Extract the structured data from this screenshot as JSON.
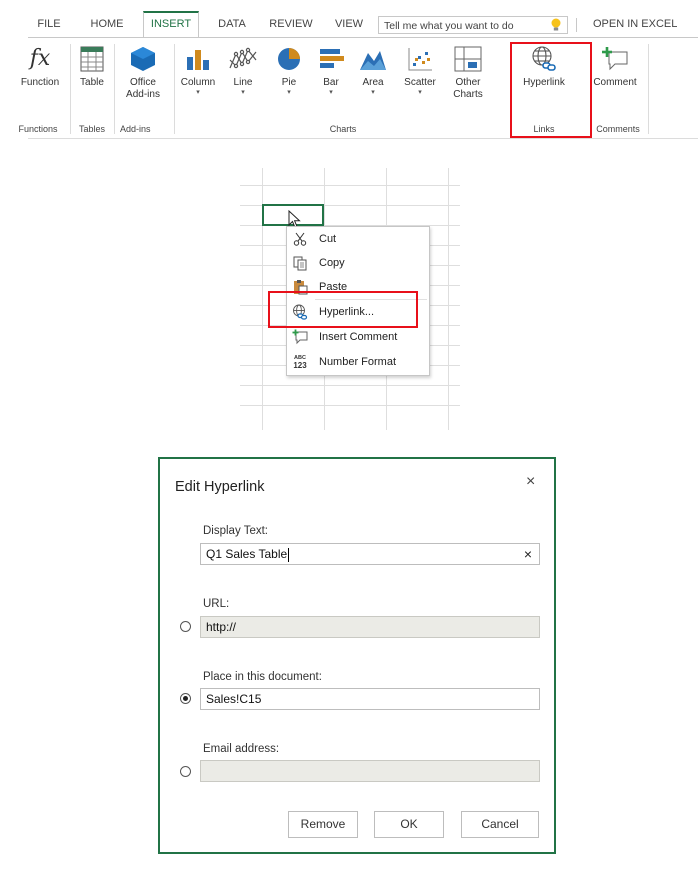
{
  "ribbon": {
    "tabs": [
      "FILE",
      "HOME",
      "INSERT",
      "DATA",
      "REVIEW",
      "VIEW"
    ],
    "active_tab": "INSERT",
    "tell_me": "Tell me what you want to do",
    "open_in_excel": "OPEN IN EXCEL",
    "buttons": {
      "function": "Function",
      "table": "Table",
      "office_addins_1": "Office",
      "office_addins_2": "Add-ins",
      "column": "Column",
      "line": "Line",
      "pie": "Pie",
      "bar": "Bar",
      "area": "Area",
      "scatter": "Scatter",
      "other_charts_1": "Other",
      "other_charts_2": "Charts",
      "hyperlink": "Hyperlink",
      "comment": "Comment"
    },
    "groups": {
      "functions": "Functions",
      "tables": "Tables",
      "addins": "Add-ins",
      "charts": "Charts",
      "links": "Links",
      "comments": "Comments"
    },
    "function_glyph": "fx",
    "accent_color": "#217346",
    "highlight_color": "#e8101a"
  },
  "context_menu": {
    "items": [
      {
        "label": "Cut",
        "icon": "scissors-icon"
      },
      {
        "label": "Copy",
        "icon": "copy-icon"
      },
      {
        "label": "Paste",
        "icon": "clipboard-paste-icon"
      },
      {
        "label": "Hyperlink...",
        "icon": "hyperlink-icon"
      },
      {
        "label": "Insert Comment",
        "icon": "comment-icon"
      },
      {
        "label": "Number Format",
        "icon": "number-format-icon"
      }
    ],
    "number_format_icon_top": "ABC",
    "number_format_icon_bottom": "123"
  },
  "dialog": {
    "title": "Edit Hyperlink",
    "close_glyph": "×",
    "display_text_label": "Display Text:",
    "display_text_value": "Q1 Sales Table",
    "clear_glyph": "×",
    "url_label": "URL:",
    "url_value": "http://",
    "place_label": "Place in this document:",
    "place_value": "Sales!C15",
    "email_label": "Email address:",
    "email_value": "",
    "selected_option": "place",
    "buttons": {
      "remove": "Remove",
      "ok": "OK",
      "cancel": "Cancel"
    }
  }
}
